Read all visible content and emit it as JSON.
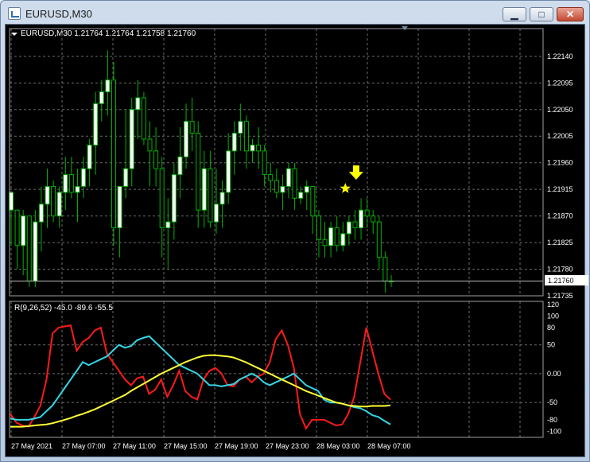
{
  "window": {
    "title": "EURUSD,M30",
    "min_label": "▁",
    "max_label": "□",
    "close_label": "✕"
  },
  "chart_info": "EURUSD,M30  1.21764 1.21764 1.21758 1.21760",
  "price_tag": "1.21760",
  "indicator_label": "R(9,26,52) -45.0 -89.6 -55.5",
  "colors": {
    "background": "#000000",
    "grid": "#6b6b6b",
    "bull": "#ffffff",
    "bear": "#000000",
    "wick": "#00b400",
    "red": "#ff1a1a",
    "cyan": "#33d6e6",
    "yellow": "#ffff33",
    "marker": "#ffff00"
  },
  "chart_data": [
    {
      "type": "candlestick",
      "symbol": "EURUSD",
      "timeframe": "M30",
      "ylim": [
        1.21735,
        1.2216
      ],
      "y_ticks": [
        "1.22140",
        "1.22095",
        "1.22050",
        "1.22005",
        "1.21960",
        "1.21915",
        "1.21870",
        "1.21825",
        "1.21780",
        "1.21735"
      ],
      "x_ticks": [
        "27 May 2021",
        "27 May 07:00",
        "27 May 11:00",
        "27 May 15:00",
        "27 May 19:00",
        "27 May 23:00",
        "28 May 03:00",
        "28 May 07:00"
      ],
      "current_price": 1.2176,
      "candles": [
        [
          1.2188,
          1.2191,
          1.2182,
          1.2191
        ],
        [
          1.2188,
          1.2188,
          1.2178,
          1.2182
        ],
        [
          1.2182,
          1.2188,
          1.2177,
          1.2187
        ],
        [
          1.2187,
          1.2187,
          1.2175,
          1.2176
        ],
        [
          1.2176,
          1.2188,
          1.2175,
          1.2186
        ],
        [
          1.2186,
          1.2192,
          1.2181,
          1.2189
        ],
        [
          1.2189,
          1.2195,
          1.2185,
          1.2192
        ],
        [
          1.2192,
          1.2193,
          1.2186,
          1.2187
        ],
        [
          1.2187,
          1.2192,
          1.2185,
          1.2191
        ],
        [
          1.2191,
          1.2197,
          1.2188,
          1.2194
        ],
        [
          1.2194,
          1.2197,
          1.219,
          1.2191
        ],
        [
          1.2191,
          1.2195,
          1.2186,
          1.2192
        ],
        [
          1.2192,
          1.2197,
          1.219,
          1.2195
        ],
        [
          1.2195,
          1.22,
          1.2192,
          1.2199
        ],
        [
          1.2199,
          1.2208,
          1.2194,
          1.2206
        ],
        [
          1.2206,
          1.221,
          1.2203,
          1.2208
        ],
        [
          1.2208,
          1.2215,
          1.2204,
          1.221
        ],
        [
          1.221,
          1.2213,
          1.2182,
          1.2185
        ],
        [
          1.2185,
          1.219,
          1.218,
          1.2192
        ],
        [
          1.2192,
          1.2205,
          1.219,
          1.2195
        ],
        [
          1.2195,
          1.2207,
          1.2192,
          1.2205
        ],
        [
          1.2205,
          1.221,
          1.22,
          1.2207
        ],
        [
          1.2207,
          1.2208,
          1.2199,
          1.22
        ],
        [
          1.22,
          1.2203,
          1.2192,
          1.2198
        ],
        [
          1.2198,
          1.2202,
          1.2192,
          1.2195
        ],
        [
          1.2195,
          1.2197,
          1.218,
          1.2185
        ],
        [
          1.2185,
          1.219,
          1.2178,
          1.2186
        ],
        [
          1.2186,
          1.2196,
          1.2183,
          1.2194
        ],
        [
          1.2194,
          1.2202,
          1.219,
          1.2197
        ],
        [
          1.2197,
          1.2206,
          1.2195,
          1.2203
        ],
        [
          1.2203,
          1.2207,
          1.2198,
          1.2201
        ],
        [
          1.2201,
          1.2203,
          1.2185,
          1.2188
        ],
        [
          1.2188,
          1.2198,
          1.2185,
          1.2195
        ],
        [
          1.2195,
          1.2198,
          1.2185,
          1.2186
        ],
        [
          1.2186,
          1.2195,
          1.2184,
          1.2189
        ],
        [
          1.2189,
          1.2193,
          1.2185,
          1.2191
        ],
        [
          1.2191,
          1.2201,
          1.2189,
          1.2198
        ],
        [
          1.2198,
          1.2203,
          1.2194,
          1.2201
        ],
        [
          1.2201,
          1.2206,
          1.2198,
          1.2203
        ],
        [
          1.2203,
          1.2204,
          1.2195,
          1.2198
        ],
        [
          1.2198,
          1.22,
          1.2196,
          1.2199
        ],
        [
          1.2199,
          1.2202,
          1.2195,
          1.2198
        ],
        [
          1.2198,
          1.2199,
          1.2192,
          1.2194
        ],
        [
          1.2194,
          1.2196,
          1.2191,
          1.2193
        ],
        [
          1.2193,
          1.2195,
          1.219,
          1.2191
        ],
        [
          1.2191,
          1.2194,
          1.2188,
          1.2192
        ],
        [
          1.2192,
          1.2196,
          1.219,
          1.2195
        ],
        [
          1.2195,
          1.2196,
          1.2188,
          1.219
        ],
        [
          1.219,
          1.2192,
          1.2189,
          1.2191
        ],
        [
          1.2191,
          1.2193,
          1.2188,
          1.2192
        ],
        [
          1.2192,
          1.2192,
          1.2184,
          1.2187
        ],
        [
          1.2187,
          1.2188,
          1.218,
          1.2183
        ],
        [
          1.2183,
          1.2186,
          1.218,
          1.2182
        ],
        [
          1.2182,
          1.2186,
          1.218,
          1.2185
        ],
        [
          1.2185,
          1.2187,
          1.2181,
          1.2182
        ],
        [
          1.2182,
          1.2186,
          1.2181,
          1.2184
        ],
        [
          1.2184,
          1.2187,
          1.2182,
          1.2186
        ],
        [
          1.2186,
          1.2188,
          1.2183,
          1.2185
        ],
        [
          1.2185,
          1.219,
          1.2183,
          1.2188
        ],
        [
          1.2188,
          1.219,
          1.2185,
          1.2187
        ],
        [
          1.2187,
          1.2188,
          1.2184,
          1.2186
        ],
        [
          1.2186,
          1.2187,
          1.2178,
          1.218
        ],
        [
          1.218,
          1.2181,
          1.2174,
          1.2176
        ],
        [
          1.2176,
          1.2177,
          1.2175,
          1.2176
        ]
      ],
      "markers": [
        {
          "type": "arrow-down",
          "candle": 56
        },
        {
          "type": "star",
          "candle": 55
        }
      ]
    },
    {
      "type": "line",
      "title": "R(9,26,52) -45.0 -89.6 -55.5",
      "ylim": [
        -105,
        120
      ],
      "y_ticks": [
        "120",
        "100",
        "80",
        "50",
        "0.00",
        "-50",
        "-80",
        "-100"
      ],
      "series": [
        {
          "color": "red",
          "values": [
            -70,
            -85,
            -90,
            -92,
            -75,
            -55,
            -10,
            70,
            80,
            82,
            84,
            40,
            55,
            62,
            75,
            80,
            35,
            20,
            5,
            -10,
            -20,
            -8,
            -5,
            -35,
            -28,
            -10,
            -40,
            -20,
            5,
            -30,
            -40,
            -45,
            -10,
            5,
            10,
            0,
            -20,
            -22,
            -10,
            -5,
            -15,
            -5,
            0,
            20,
            60,
            75,
            50,
            10,
            -70,
            -95,
            -80,
            -80,
            -80,
            -85,
            -90,
            -88,
            -70,
            -40,
            20,
            80,
            40,
            0,
            -35,
            -45
          ]
        },
        {
          "color": "cyan",
          "values": [
            -78,
            -80,
            -80,
            -80,
            -78,
            -75,
            -65,
            -55,
            -40,
            -25,
            -10,
            5,
            20,
            15,
            20,
            25,
            30,
            40,
            50,
            45,
            48,
            58,
            62,
            65,
            55,
            45,
            35,
            25,
            15,
            10,
            5,
            0,
            -10,
            -20,
            -20,
            -22,
            -20,
            -18,
            -10,
            -5,
            0,
            -5,
            -15,
            -20,
            -15,
            -10,
            -5,
            0,
            -10,
            -20,
            -25,
            -30,
            -45,
            -50,
            -50,
            -52,
            -55,
            -58,
            -60,
            -65,
            -72,
            -75,
            -82,
            -88
          ]
        },
        {
          "color": "yellow",
          "values": [
            -92,
            -92,
            -92,
            -91,
            -90,
            -89,
            -88,
            -86,
            -83,
            -80,
            -77,
            -73,
            -70,
            -66,
            -62,
            -57,
            -52,
            -47,
            -42,
            -37,
            -30,
            -24,
            -18,
            -12,
            -6,
            0,
            5,
            10,
            15,
            20,
            24,
            28,
            31,
            32,
            32,
            31,
            30,
            28,
            24,
            20,
            15,
            10,
            5,
            0,
            -5,
            -10,
            -15,
            -20,
            -25,
            -30,
            -34,
            -38,
            -42,
            -46,
            -50,
            -52,
            -55,
            -56,
            -57,
            -57,
            -56,
            -56,
            -56,
            -55
          ]
        }
      ]
    }
  ]
}
